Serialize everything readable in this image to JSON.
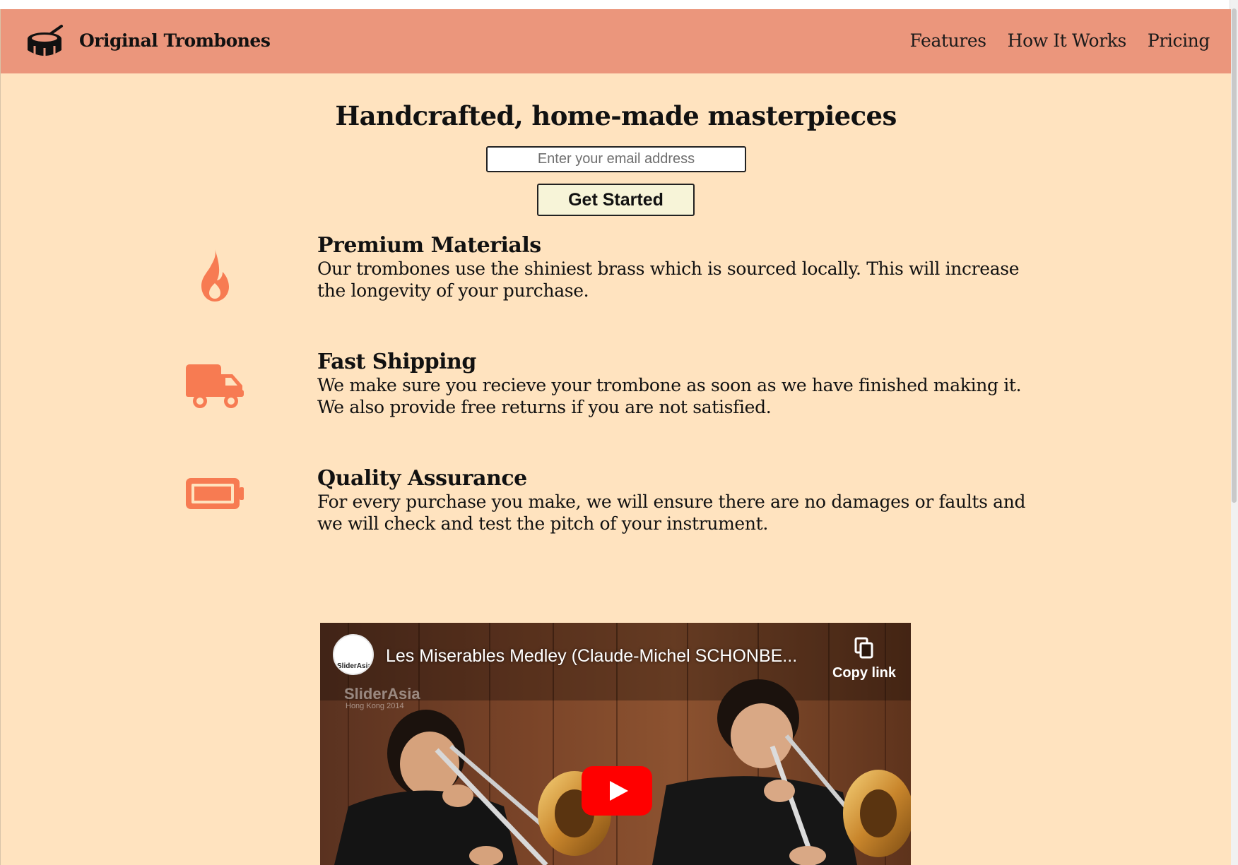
{
  "header": {
    "brand": "Original Trombones",
    "nav": [
      {
        "label": "Features"
      },
      {
        "label": "How It Works"
      },
      {
        "label": "Pricing"
      }
    ]
  },
  "hero": {
    "title": "Handcrafted, home-made masterpieces",
    "email_placeholder": "Enter your email address",
    "cta_label": "Get Started"
  },
  "features": [
    {
      "icon": "fire-icon",
      "title": "Premium Materials",
      "description": "Our trombones use the shiniest brass which is sourced locally. This will increase the longevity of your purchase."
    },
    {
      "icon": "truck-icon",
      "title": "Fast Shipping",
      "description": "We make sure you recieve your trombone as soon as we have finished making it. We also provide free returns if you are not satisfied."
    },
    {
      "icon": "battery-icon",
      "title": "Quality Assurance",
      "description": "For every purchase you make, we will ensure there are no damages or faults and we will check and test the pitch of your instrument."
    }
  ],
  "video": {
    "title": "Les Miserables Medley (Claude-Michel SCHONBE...",
    "copy_link_label": "Copy link",
    "channel_label": "SliderAsia",
    "watermark": "SliderAsia",
    "watermark_sub": "Hong Kong 2014"
  },
  "colors": {
    "header_bg": "#eb967c",
    "page_bg": "#ffe3bf",
    "icon_accent": "#f77b52",
    "cta_bg": "#f7f4d8",
    "youtube_red": "#ff0000"
  }
}
